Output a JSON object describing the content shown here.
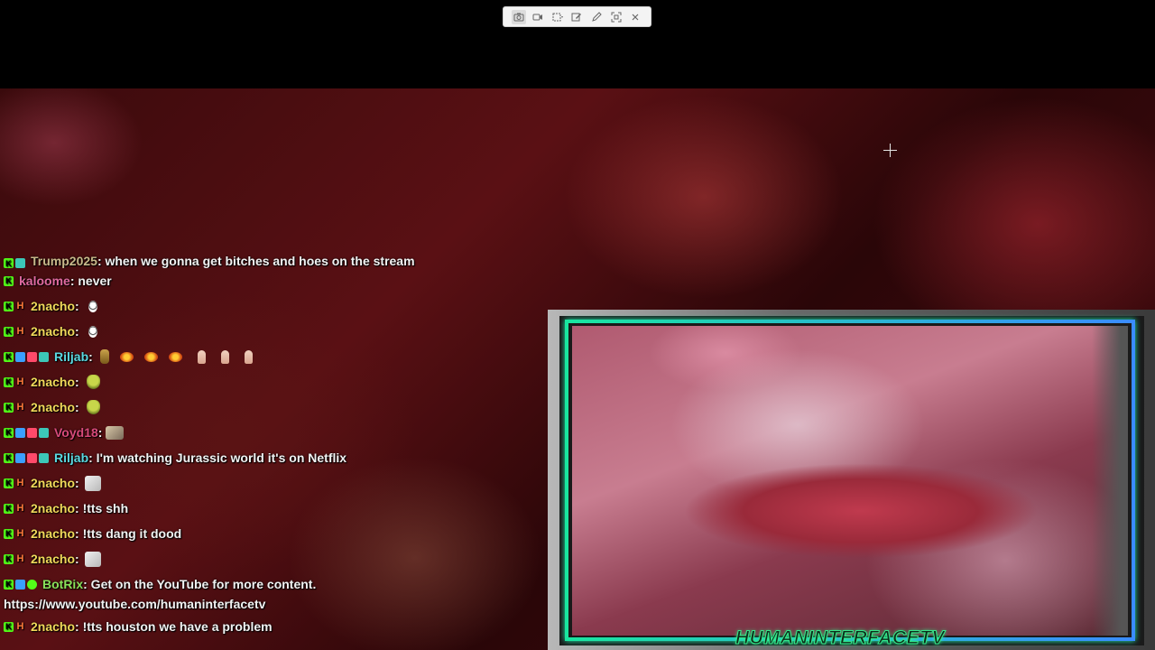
{
  "toolbar": {
    "buttons": [
      {
        "name": "screenshot",
        "icon": "camera-icon"
      },
      {
        "name": "record",
        "icon": "video-icon"
      },
      {
        "name": "select-region",
        "icon": "rectangle-select-icon"
      },
      {
        "name": "edit",
        "icon": "edit-icon"
      },
      {
        "name": "pen",
        "icon": "pen-icon"
      },
      {
        "name": "fullscreen",
        "icon": "expand-icon"
      },
      {
        "name": "close",
        "icon": "close-icon"
      }
    ]
  },
  "colors": {
    "kick_green": "#53fc18",
    "cam_border_start": "#19e6a0",
    "cam_border_end": "#3a8cff"
  },
  "chat": {
    "messages": [
      {
        "user": "Trump2025",
        "user_color": "#c8b88a",
        "text": ": when we gonna get bitches and hoes on the stream"
      },
      {
        "user": "kaloome",
        "user_color": "#e06aa0",
        "text": ": never"
      },
      {
        "user": "2nacho",
        "user_color": "#f0d85a",
        "text": ":"
      },
      {
        "user": "2nacho",
        "user_color": "#f0d85a",
        "text": ":"
      },
      {
        "user": "Riljab",
        "user_color": "#5ad8e0",
        "text": ":"
      },
      {
        "user": "2nacho",
        "user_color": "#f0d85a",
        "text": ":"
      },
      {
        "user": "2nacho",
        "user_color": "#f0d85a",
        "text": ":"
      },
      {
        "user": "Voyd18",
        "user_color": "#d84a7a",
        "text": ":"
      },
      {
        "user": "Riljab",
        "user_color": "#5ad8e0",
        "text": ": I'm watching Jurassic world it's on Netflix"
      },
      {
        "user": "2nacho",
        "user_color": "#f0d85a",
        "text": ":"
      },
      {
        "user": "2nacho",
        "user_color": "#f0d85a",
        "text": ": !tts shh"
      },
      {
        "user": "2nacho",
        "user_color": "#f0d85a",
        "text": ": !tts dang it dood"
      },
      {
        "user": "2nacho",
        "user_color": "#f0d85a",
        "text": ":"
      },
      {
        "user": "BotRix",
        "user_color": "#8ae05a",
        "text": ": Get on the YouTube for more content.",
        "link": "https://www.youtube.com/humaninterfacetv"
      },
      {
        "user": "2nacho",
        "user_color": "#f0d85a",
        "text": ": !tts houston we have a problem"
      }
    ]
  },
  "webcam": {
    "watermark": "HUMANINTERFACETV"
  }
}
